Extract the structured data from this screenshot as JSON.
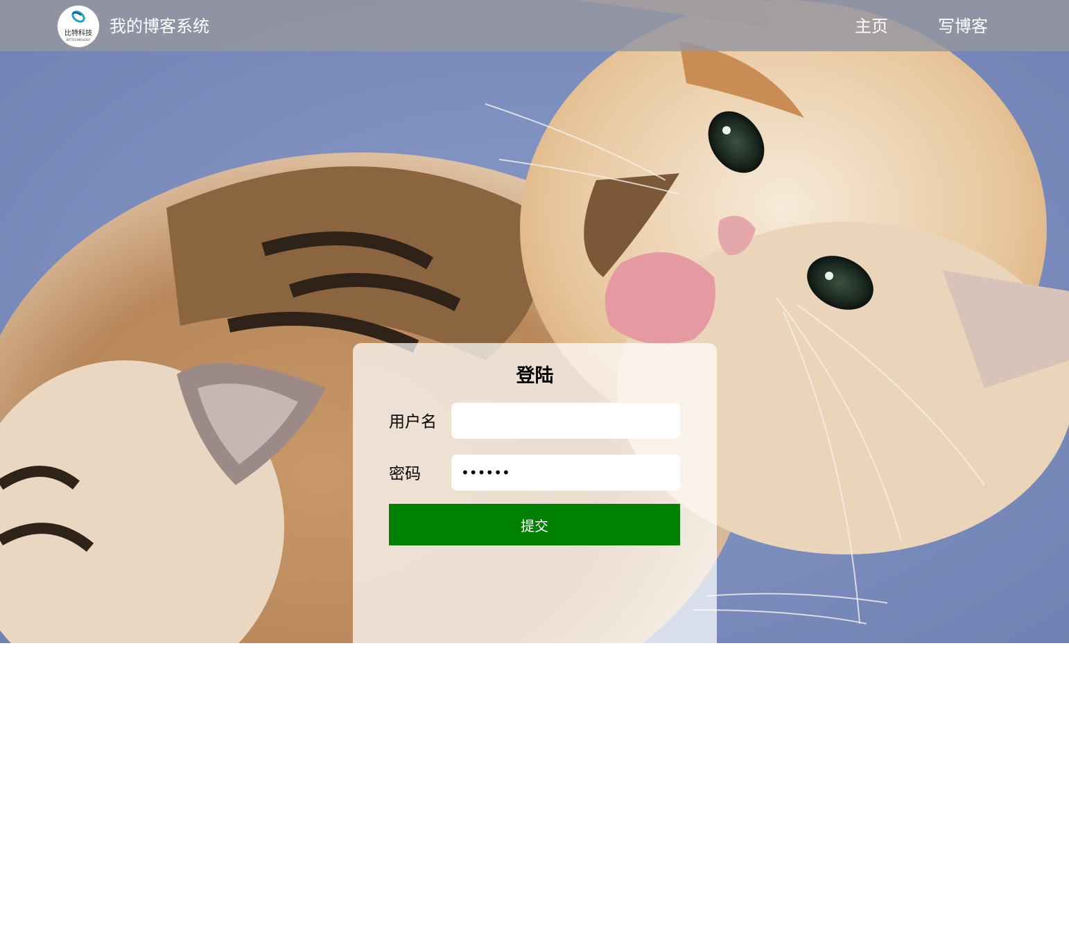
{
  "navbar": {
    "logo_text": "比特科技",
    "logo_subtext": "BIT-TECHNOLOGY",
    "site_title": "我的博客系统",
    "links": [
      {
        "label": "主页"
      },
      {
        "label": "写博客"
      }
    ]
  },
  "login": {
    "title": "登陆",
    "username_label": "用户名",
    "username_value": "",
    "password_label": "密码",
    "password_value": "••••••",
    "submit_label": "提交"
  },
  "colors": {
    "navbar_bg": "#96969f",
    "submit_bg": "#008000",
    "background_blue": "#7d8fbe",
    "page_bg": "#ffffff"
  }
}
